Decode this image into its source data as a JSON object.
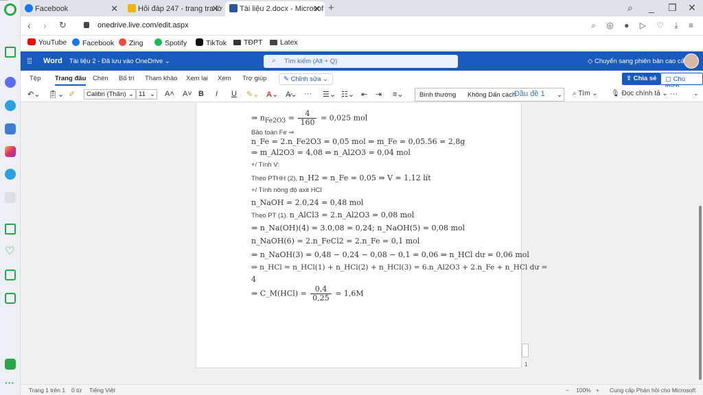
{
  "browser": {
    "tabs": [
      {
        "title": "Facebook",
        "color": "#1877f2"
      },
      {
        "title": "Hỏi đáp 247 - trang tra lờ",
        "color": "#f2b705"
      },
      {
        "title": "Tài liệu 2.docx - Microsof",
        "color": "#2b579a"
      }
    ],
    "url": "onedrive.live.com/edit.aspx",
    "bookmarks": [
      {
        "label": "YouTube",
        "color": "#ff0000"
      },
      {
        "label": "Facebook",
        "color": "#1877f2"
      },
      {
        "label": "Zing",
        "color": "#e94d3a"
      },
      {
        "label": "Spotify",
        "color": "#1db954"
      },
      {
        "label": "TikTok",
        "color": "#111111"
      },
      {
        "label": "TĐPT",
        "color": "#333333"
      },
      {
        "label": "Latex",
        "color": "#444444"
      }
    ]
  },
  "word": {
    "app_name": "Word",
    "doc_title": "Tài liệu 2 - Đã lưu vào OneDrive ⌄",
    "search_placeholder": "Tìm kiếm (Alt + Q)",
    "premium_label": "Chuyển sang phiên bản cao cấp",
    "ribbon_tabs": [
      "Tệp",
      "Trang đầu",
      "Chèn",
      "Bố trí",
      "Tham khảo",
      "Xem lại",
      "Xem",
      "Trợ giúp"
    ],
    "edit_mode": "Chỉnh sửa ⌄",
    "share": "Chia sẻ",
    "comment": "Chú thích",
    "font_name": "Calibri (Thân)",
    "font_size": "11",
    "styles": [
      "Bình thường",
      "Không Dấn cách",
      "Đầu đề 1"
    ],
    "find": "Tìm",
    "dictate": "Đọc chính tả"
  },
  "document": {
    "lines": {
      "l1_pre": "⇒ n",
      "l1_sub": "Fe2O3",
      "l1_eq": " = ",
      "l1_num": "4",
      "l1_den": "160",
      "l1_post": " = 0,025 mol",
      "l2": "Bảo toàn Fe ⇒",
      "l3": "n_Fe = 2.n_Fe2O3 = 0,05 mol ⇒ m_Fe = 0,05.56 = 2,8g",
      "l4": "⇒ m_Al2O3 = 4,08 ⇒ n_Al2O3 = 0,04 mol",
      "l5": "+/ Tính V:",
      "l6_text": "Theo PTHH (2), ",
      "l6_math": "n_H2 = n_Fe = 0,05 ⇒ V = 1,12 lít",
      "l7": "+/ Tính nồng độ axit HCl",
      "l8": "n_NaOH = 2.0,24 = 0,48 mol",
      "l9_text": "Theo PT (1). ",
      "l9_math": "n_AlCl3 = 2.n_Al2O3 = 0,08 mol",
      "l10": "⇒ n_Na(OH)(4) = 3.0,08 = 0,24; n_NaOH(5) = 0,08 mol",
      "l11": "n_NaOH(6) = 2.n_FeCl2 = 2.n_Fe = 0,1 mol",
      "l12": "⇒ n_NaOH(3) = 0,48 − 0,24 − 0,08 − 0,1 = 0,06 ⇒ n_HCl dư = 0,06 mol",
      "l13": "⇒ n_HCl = n_HCl(1) + n_HCl(2) + n_HCl(3) = 6.n_Al2O3 + 2.n_Fe + n_HCl dư =",
      "l14": "4",
      "l15_pre": "⇒ C_M(HCl) = ",
      "l15_num": "0,4",
      "l15_den": "0,25",
      "l15_post": " = 1,6M"
    },
    "page_number": "1"
  },
  "status": {
    "page": "Trang 1 trên 1",
    "words": "0 từ",
    "language": "Tiếng Việt",
    "zoom": "100%",
    "feedback": "Cung cấp Phản hồi cho Microsoft"
  }
}
